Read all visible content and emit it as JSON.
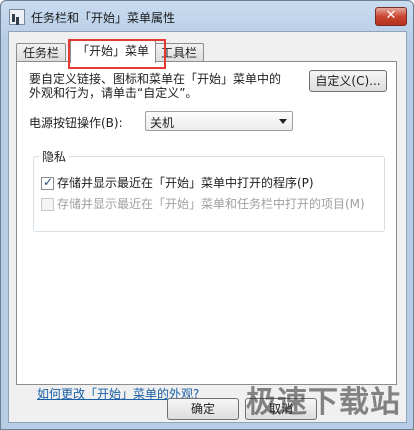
{
  "window": {
    "title": "任务栏和「开始」菜单属性",
    "close_label": "✕"
  },
  "tabs": [
    {
      "label": "任务栏"
    },
    {
      "label": "「开始」菜单"
    },
    {
      "label": "工具栏"
    }
  ],
  "panel": {
    "description_line1": "要自定义链接、图标和菜单在「开始」菜单中的",
    "description_line2": "外观和行为，请单击“自定义”。",
    "customize_button": "自定义(C)...",
    "power_label": "电源按钮操作(B):",
    "power_value": "关机",
    "privacy_title": "隐私",
    "privacy_items": [
      {
        "label": "存储并显示最近在「开始」菜单中打开的程序(P)",
        "checked": true,
        "enabled": true
      },
      {
        "label": "存储并显示最近在「开始」菜单和任务栏中打开的项目(M)",
        "checked": false,
        "enabled": false
      }
    ],
    "help_link": "如何更改「开始」菜单的外观?"
  },
  "buttons": {
    "ok": "确定",
    "cancel": "取消"
  },
  "watermark": "极速下载站"
}
